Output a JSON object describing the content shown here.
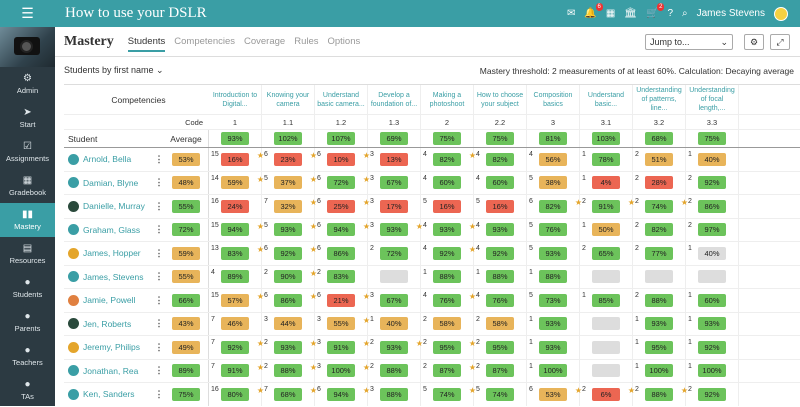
{
  "app": {
    "title": "How to use your DSLR",
    "user_name": "James Stevens",
    "notif_badge": "6",
    "cart_badge": "2"
  },
  "sidebar": {
    "items": [
      {
        "label": "Admin",
        "icon": "⚙"
      },
      {
        "label": "Start",
        "icon": "➤"
      },
      {
        "label": "Assignments",
        "icon": "☑"
      },
      {
        "label": "Gradebook",
        "icon": "▦"
      },
      {
        "label": "Mastery",
        "icon": "▮▮"
      },
      {
        "label": "Resources",
        "icon": "▤"
      },
      {
        "label": "Students",
        "icon": "●"
      },
      {
        "label": "Parents",
        "icon": "●"
      },
      {
        "label": "Teachers",
        "icon": "●"
      },
      {
        "label": "TAs",
        "icon": "●"
      }
    ]
  },
  "header": {
    "title": "Mastery",
    "tabs": [
      "Students",
      "Competencies",
      "Coverage",
      "Rules",
      "Options"
    ],
    "jump_label": "Jump to..."
  },
  "subbar": {
    "sort_label": "Students by first name",
    "threshold": "Mastery threshold: 2 measurements of at least 60%.",
    "calculation": "Calculation: Decaying average"
  },
  "grid": {
    "competencies_label": "Competencies",
    "code_label": "Code",
    "student_label": "Student",
    "average_label": "Average",
    "competencies": [
      {
        "title": "Introduction to Digital...",
        "code": "1",
        "avg": "93%",
        "avg_color": "g"
      },
      {
        "title": "Knowing your camera",
        "code": "1.1",
        "avg": "102%",
        "avg_color": "g"
      },
      {
        "title": "Understand basic camera...",
        "code": "1.2",
        "avg": "107%",
        "avg_color": "g"
      },
      {
        "title": "Develop a foundation of...",
        "code": "1.3",
        "avg": "69%",
        "avg_color": "g"
      },
      {
        "title": "Making a photoshoot",
        "code": "2",
        "avg": "75%",
        "avg_color": "g"
      },
      {
        "title": "How to choose your subject",
        "code": "2.2",
        "avg": "75%",
        "avg_color": "g"
      },
      {
        "title": "Composition basics",
        "code": "3",
        "avg": "81%",
        "avg_color": "g"
      },
      {
        "title": "Understand basic...",
        "code": "3.1",
        "avg": "103%",
        "avg_color": "g"
      },
      {
        "title": "Understanding of patterns, line...",
        "code": "3.2",
        "avg": "68%",
        "avg_color": "g"
      },
      {
        "title": "Understanding of focal length,...",
        "code": "3.3",
        "avg": "75%",
        "avg_color": "g"
      }
    ],
    "students": [
      {
        "name": "Arnold, Bella",
        "avatar": "#3a9ea5",
        "avg": "53%",
        "avg_color": "o",
        "cells": [
          [
            "15",
            "16%",
            "r",
            true
          ],
          [
            "6",
            "23%",
            "r",
            true
          ],
          [
            "6",
            "10%",
            "r",
            true
          ],
          [
            "3",
            "13%",
            "r",
            false
          ],
          [
            "4",
            "82%",
            "g",
            true
          ],
          [
            "4",
            "82%",
            "g",
            false
          ],
          [
            "4",
            "56%",
            "o",
            false
          ],
          [
            "1",
            "78%",
            "g",
            false
          ],
          [
            "2",
            "51%",
            "o",
            false
          ],
          [
            "1",
            "40%",
            "o",
            false
          ]
        ]
      },
      {
        "name": "Damian, Blyne",
        "avatar": "#3a9ea5",
        "avg": "48%",
        "avg_color": "o",
        "cells": [
          [
            "14",
            "59%",
            "o",
            true
          ],
          [
            "5",
            "37%",
            "o",
            true
          ],
          [
            "6",
            "72%",
            "g",
            true
          ],
          [
            "3",
            "67%",
            "g",
            false
          ],
          [
            "4",
            "60%",
            "g",
            false
          ],
          [
            "4",
            "60%",
            "g",
            false
          ],
          [
            "5",
            "38%",
            "o",
            false
          ],
          [
            "1",
            "4%",
            "r",
            false
          ],
          [
            "2",
            "28%",
            "r",
            false
          ],
          [
            "2",
            "92%",
            "g",
            false
          ]
        ]
      },
      {
        "name": "Danielle, Murray",
        "avatar": "#2a4a3c",
        "avg": "55%",
        "avg_color": "g",
        "cells": [
          [
            "16",
            "24%",
            "r",
            false
          ],
          [
            "7",
            "32%",
            "o",
            true
          ],
          [
            "6",
            "25%",
            "r",
            true
          ],
          [
            "3",
            "17%",
            "r",
            false
          ],
          [
            "5",
            "16%",
            "r",
            false
          ],
          [
            "5",
            "16%",
            "r",
            false
          ],
          [
            "6",
            "82%",
            "g",
            true
          ],
          [
            "2",
            "91%",
            "g",
            true
          ],
          [
            "2",
            "74%",
            "g",
            true
          ],
          [
            "2",
            "86%",
            "g",
            false
          ]
        ]
      },
      {
        "name": "Graham, Glass",
        "avatar": "#3a9ea5",
        "avg": "72%",
        "avg_color": "g",
        "cells": [
          [
            "15",
            "94%",
            "g",
            true
          ],
          [
            "5",
            "93%",
            "g",
            true
          ],
          [
            "6",
            "94%",
            "g",
            true
          ],
          [
            "3",
            "93%",
            "g",
            true
          ],
          [
            "4",
            "93%",
            "g",
            true
          ],
          [
            "4",
            "93%",
            "g",
            false
          ],
          [
            "5",
            "76%",
            "g",
            false
          ],
          [
            "1",
            "50%",
            "o",
            false
          ],
          [
            "2",
            "82%",
            "g",
            false
          ],
          [
            "2",
            "97%",
            "g",
            false
          ]
        ]
      },
      {
        "name": "James, Hopper",
        "avatar": "#e4a52b",
        "avg": "59%",
        "avg_color": "o",
        "cells": [
          [
            "13",
            "83%",
            "g",
            true
          ],
          [
            "6",
            "92%",
            "g",
            true
          ],
          [
            "6",
            "86%",
            "g",
            false
          ],
          [
            "2",
            "72%",
            "g",
            false
          ],
          [
            "4",
            "92%",
            "g",
            true
          ],
          [
            "4",
            "92%",
            "g",
            false
          ],
          [
            "5",
            "93%",
            "g",
            false
          ],
          [
            "2",
            "65%",
            "g",
            false
          ],
          [
            "2",
            "77%",
            "g",
            false
          ],
          [
            "1",
            "40%",
            "e",
            false
          ]
        ]
      },
      {
        "name": "James, Stevens",
        "avatar": "#3a9ea5",
        "avg": "55%",
        "avg_color": "o",
        "cells": [
          [
            "4",
            "89%",
            "g",
            false
          ],
          [
            "2",
            "90%",
            "g",
            true
          ],
          [
            "2",
            "83%",
            "g",
            false
          ],
          [
            "",
            "",
            "e",
            false
          ],
          [
            "1",
            "88%",
            "g",
            false
          ],
          [
            "1",
            "88%",
            "g",
            false
          ],
          [
            "1",
            "88%",
            "g",
            false
          ],
          [
            "",
            "",
            "e",
            false
          ],
          [
            "",
            "",
            "e",
            false
          ],
          [
            "",
            "",
            "e",
            false
          ]
        ]
      },
      {
        "name": "Jamie, Powell",
        "avatar": "#e08040",
        "avg": "66%",
        "avg_color": "g",
        "cells": [
          [
            "15",
            "57%",
            "o",
            true
          ],
          [
            "6",
            "86%",
            "g",
            true
          ],
          [
            "6",
            "21%",
            "r",
            true
          ],
          [
            "3",
            "67%",
            "g",
            false
          ],
          [
            "4",
            "76%",
            "g",
            true
          ],
          [
            "4",
            "76%",
            "g",
            false
          ],
          [
            "5",
            "73%",
            "g",
            false
          ],
          [
            "1",
            "85%",
            "g",
            false
          ],
          [
            "2",
            "88%",
            "g",
            false
          ],
          [
            "1",
            "60%",
            "g",
            false
          ]
        ]
      },
      {
        "name": "Jen, Roberts",
        "avatar": "#2a4a3c",
        "avg": "43%",
        "avg_color": "o",
        "cells": [
          [
            "7",
            "46%",
            "o",
            false
          ],
          [
            "3",
            "44%",
            "o",
            false
          ],
          [
            "3",
            "55%",
            "o",
            true
          ],
          [
            "1",
            "40%",
            "o",
            false
          ],
          [
            "2",
            "58%",
            "o",
            false
          ],
          [
            "2",
            "58%",
            "o",
            false
          ],
          [
            "1",
            "93%",
            "g",
            false
          ],
          [
            "",
            "",
            "e",
            false
          ],
          [
            "1",
            "93%",
            "g",
            false
          ],
          [
            "1",
            "93%",
            "g",
            false
          ]
        ]
      },
      {
        "name": "Jeremy, Philips",
        "avatar": "#e4a52b",
        "avg": "49%",
        "avg_color": "o",
        "cells": [
          [
            "7",
            "92%",
            "g",
            true
          ],
          [
            "2",
            "93%",
            "g",
            true
          ],
          [
            "3",
            "91%",
            "g",
            true
          ],
          [
            "2",
            "93%",
            "g",
            true
          ],
          [
            "2",
            "95%",
            "g",
            true
          ],
          [
            "2",
            "95%",
            "g",
            false
          ],
          [
            "1",
            "93%",
            "g",
            false
          ],
          [
            "",
            "",
            "e",
            false
          ],
          [
            "1",
            "95%",
            "g",
            false
          ],
          [
            "1",
            "92%",
            "g",
            false
          ]
        ]
      },
      {
        "name": "Jonathan, Rea",
        "avatar": "#3a9ea5",
        "avg": "89%",
        "avg_color": "g",
        "cells": [
          [
            "7",
            "91%",
            "g",
            true
          ],
          [
            "2",
            "88%",
            "g",
            true
          ],
          [
            "3",
            "100%",
            "g",
            true
          ],
          [
            "2",
            "88%",
            "g",
            false
          ],
          [
            "2",
            "87%",
            "g",
            true
          ],
          [
            "2",
            "87%",
            "g",
            false
          ],
          [
            "1",
            "100%",
            "g",
            false
          ],
          [
            "",
            "",
            "e",
            false
          ],
          [
            "1",
            "100%",
            "g",
            false
          ],
          [
            "1",
            "100%",
            "g",
            false
          ]
        ]
      },
      {
        "name": "Ken, Sanders",
        "avatar": "#3a9ea5",
        "avg": "75%",
        "avg_color": "g",
        "cells": [
          [
            "16",
            "80%",
            "g",
            true
          ],
          [
            "7",
            "68%",
            "g",
            true
          ],
          [
            "6",
            "94%",
            "g",
            true
          ],
          [
            "3",
            "88%",
            "g",
            false
          ],
          [
            "5",
            "74%",
            "g",
            true
          ],
          [
            "5",
            "74%",
            "g",
            false
          ],
          [
            "6",
            "53%",
            "o",
            true
          ],
          [
            "2",
            "6%",
            "r",
            true
          ],
          [
            "2",
            "88%",
            "g",
            true
          ],
          [
            "2",
            "92%",
            "g",
            false
          ]
        ]
      }
    ]
  }
}
